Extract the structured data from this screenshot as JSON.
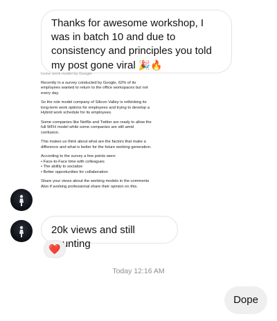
{
  "messages": {
    "first": {
      "text": "Thanks for awesome workshop, I was in batch 10 and due to consistency and principles you told my post gone viral",
      "emojis": "🎉🔥"
    },
    "shared_post": {
      "top_line": "home work model by Google",
      "paragraphs": [
        "Recently in a survey conducted by Google, 62% of its employees wanted to return to the office workspaces but not every day.",
        "So the role model company of Silicon Valley is rethinking its long-term work options for employees and trying to develop a Hybrid work schedule for its employees.",
        "Some companies like Netflix and Twitter are ready to allow the full WFH model while some companies are still amid confusion.",
        "This makes us think about what are the factors that make a difference and what is better for the future working generation.",
        "According to the survey a few points were:\n• Face-to-Face time with colleagues\n• The ability to socialize\n• Better opportunities for collaboration",
        "Share your views about the working models in the comments\nAlso if working professional share their opinion on this."
      ]
    },
    "second": {
      "text": "20k views and still counting",
      "reaction": "❤️"
    },
    "timestamp": "Today 12:16 AM",
    "reply": {
      "text": "Dope"
    }
  },
  "colors": {
    "reaction_heart": "#e0242b",
    "timestamp": "#8e8e8e",
    "sent_bubble": "#efefef"
  },
  "icons": {
    "avatar": "contact-avatar-icon",
    "reaction": "heart-reaction-icon"
  }
}
